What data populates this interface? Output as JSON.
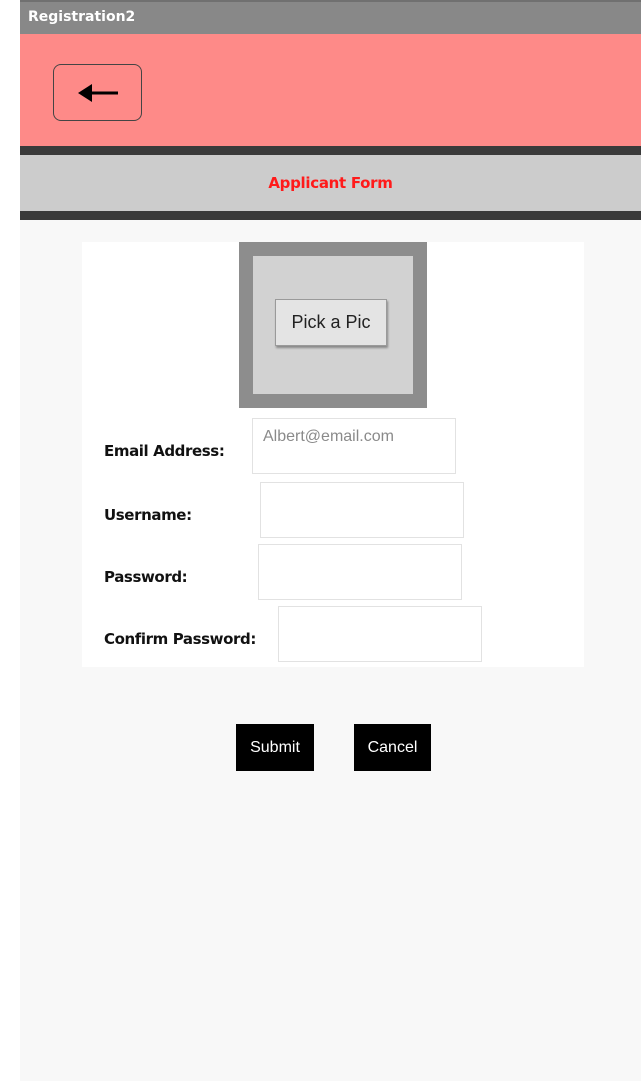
{
  "window": {
    "title": "Registration2"
  },
  "header": {
    "back_icon": "left-arrow-icon",
    "colors": {
      "band": "#fe8a88",
      "divider": "#3a3a3a"
    }
  },
  "section": {
    "title": "Applicant Form",
    "title_color": "#ff1a1a"
  },
  "picture": {
    "button_label": "Pick a Pic"
  },
  "form": {
    "email": {
      "label": "Email Address:",
      "value": "",
      "placeholder": "Albert@email.com"
    },
    "username": {
      "label": "Username:",
      "value": "",
      "placeholder": ""
    },
    "password": {
      "label": "Password:",
      "value": "",
      "placeholder": ""
    },
    "confirm_password": {
      "label": "Confirm Password:",
      "value": "",
      "placeholder": ""
    }
  },
  "actions": {
    "submit_label": "Submit",
    "cancel_label": "Cancel"
  }
}
